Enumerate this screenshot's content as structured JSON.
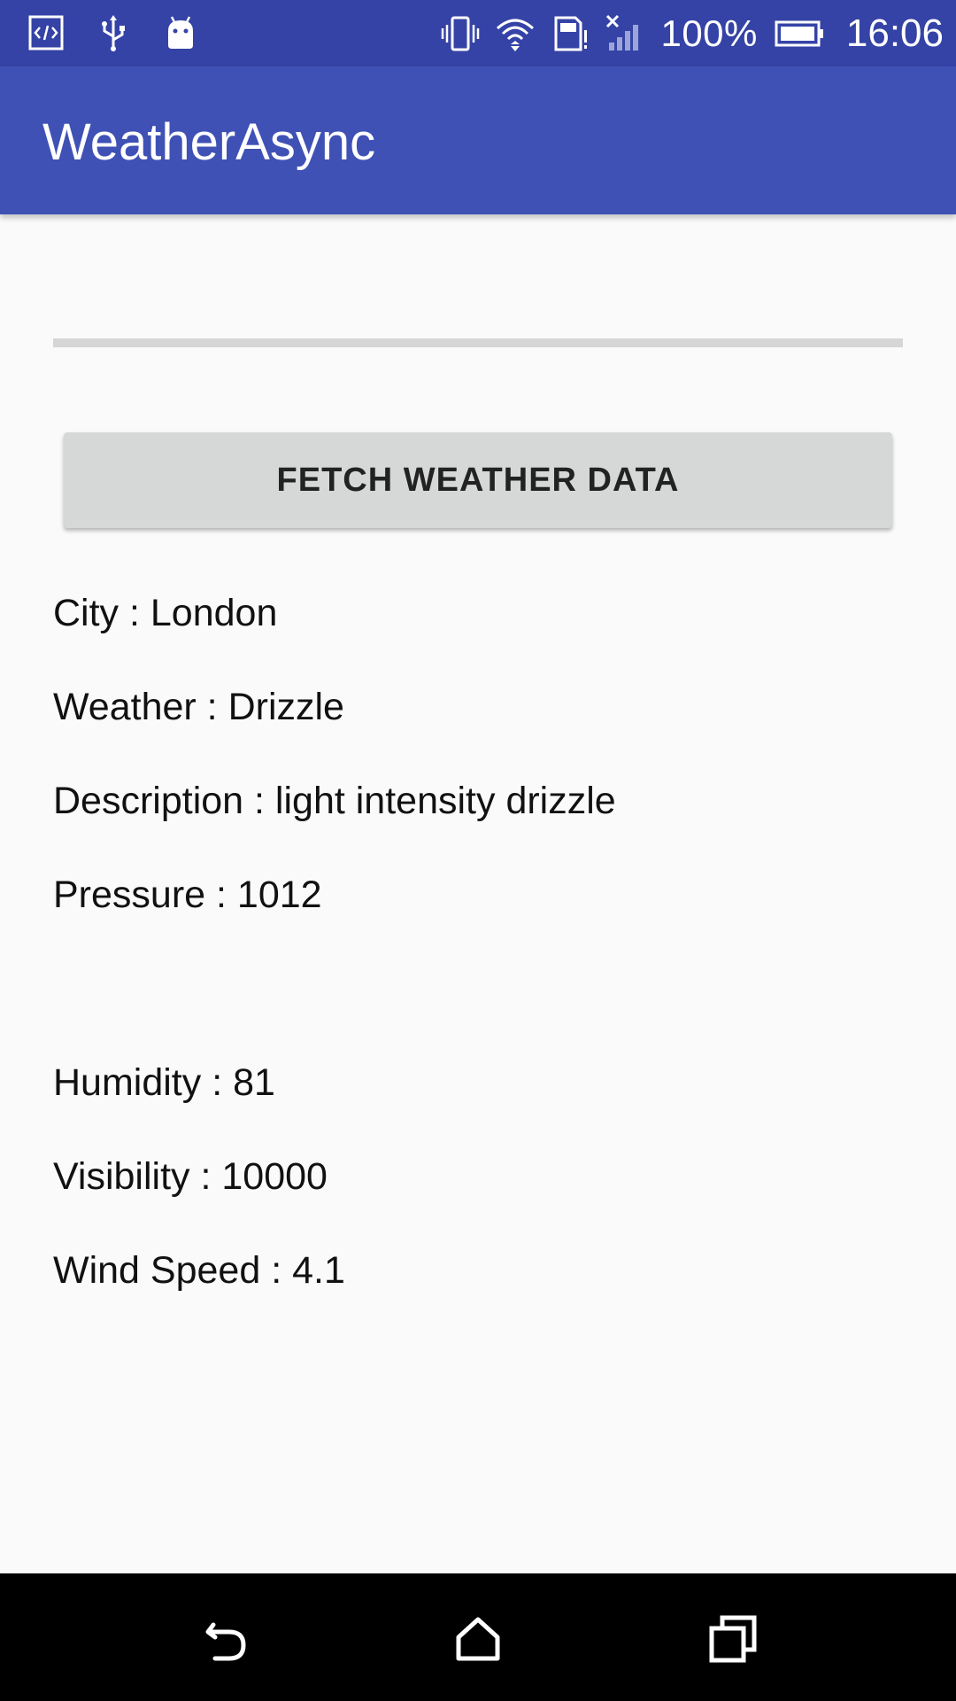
{
  "status_bar": {
    "battery": "100%",
    "time": "16:06",
    "icons": [
      "developer-code-icon",
      "usb-icon",
      "android-debug-icon",
      "vibrate-icon",
      "wifi-icon",
      "sim-alert-icon",
      "no-signal-icon",
      "battery-icon"
    ]
  },
  "app_bar": {
    "title": "WeatherAsync"
  },
  "progress": {
    "value": 0
  },
  "fetch_button": {
    "label": "FETCH WEATHER DATA"
  },
  "weather": {
    "city": "City : London",
    "weather": "Weather : Drizzle",
    "description": "Description : light intensity drizzle",
    "pressure": "Pressure : 1012",
    "humidity": "Humidity : 81",
    "visibility": "Visibility : 10000",
    "wind_speed": "Wind Speed : 4.1"
  },
  "nav_bar": {
    "icons": [
      "back-icon",
      "home-icon",
      "recents-icon"
    ]
  },
  "colors": {
    "status_bar": "#3543A6",
    "app_bar": "#3F51B5",
    "background": "#FAFAFA",
    "button": "#D6D7D7",
    "progress_track": "#D6D6D6",
    "nav_bar": "#000000"
  }
}
